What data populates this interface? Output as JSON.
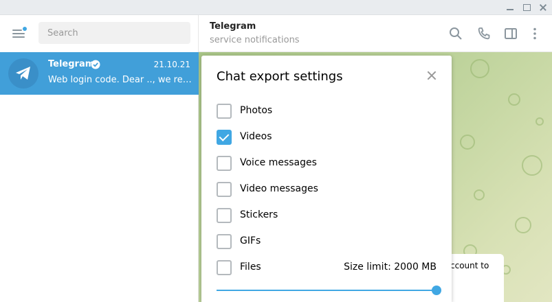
{
  "window": {
    "controls": [
      "minimize",
      "maximize",
      "close"
    ]
  },
  "sidebar": {
    "search": {
      "placeholder": "Search",
      "value": ""
    },
    "chats": [
      {
        "name": "Telegram",
        "verified": true,
        "date": "21.10.21",
        "preview": "Web login code. Dear .., we receive...",
        "selected": true
      }
    ]
  },
  "header": {
    "title": "Telegram",
    "subtitle": "service notifications",
    "icons": [
      "search-icon",
      "phone-icon",
      "sidebar-toggle-icon",
      "more-icon"
    ]
  },
  "message_preview": {
    "text": "ccount to"
  },
  "dialog": {
    "title": "Chat export settings",
    "options": [
      {
        "label": "Photos",
        "checked": false
      },
      {
        "label": "Videos",
        "checked": true
      },
      {
        "label": "Voice messages",
        "checked": false
      },
      {
        "label": "Video messages",
        "checked": false
      },
      {
        "label": "Stickers",
        "checked": false
      },
      {
        "label": "GIFs",
        "checked": false
      },
      {
        "label": "Files",
        "checked": false
      }
    ],
    "size_limit_text": "Size limit: 2000 MB",
    "size_limit_fraction": 1.0
  },
  "colors": {
    "accent": "#40a7e3",
    "selected_chat": "#419fd9",
    "muted_text": "#999999"
  }
}
